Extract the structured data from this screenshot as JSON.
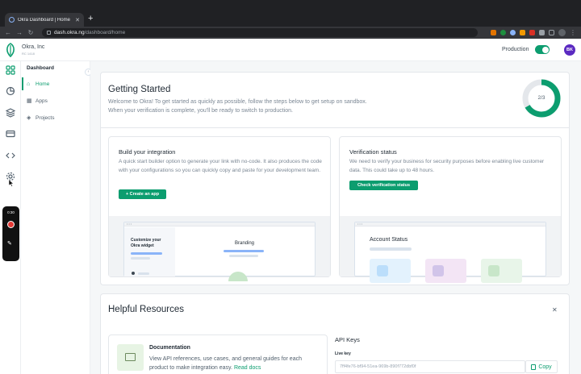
{
  "browser": {
    "tab_title": "Okra Dashboard | Home",
    "tab_close": "✕",
    "new_tab": "+",
    "url_host": "dash.okra.ng",
    "url_path": "/dashboard/home"
  },
  "header": {
    "org_name": "Okra, Inc",
    "org_id": "RC 1418",
    "env_label": "Production",
    "production_enabled": true,
    "avatar_initials": "BK"
  },
  "sidebar": {
    "title": "Dashboard",
    "items": [
      {
        "label": "Home",
        "icon": "home-icon",
        "active": true
      },
      {
        "label": "Apps",
        "icon": "apps-icon",
        "active": false
      },
      {
        "label": "Projects",
        "icon": "projects-icon",
        "active": false
      }
    ]
  },
  "recorder": {
    "time": "0:30"
  },
  "getting_started": {
    "title": "Getting Started",
    "desc_line1": "Welcome to Okra! To get started as quickly as possible, follow the steps below to get setup on sandbox.",
    "desc_line2": "When your verification is complete, you'll be ready to switch to production.",
    "progress_label": "2/3",
    "progress_done": 2,
    "progress_total": 3
  },
  "build": {
    "title": "Build your integration",
    "desc": "A quick start builder option to generate your link with no-code. It also produces the code with your configurations so you can quickly copy and paste for your development team.",
    "button": "+ Create an app",
    "mock_left": "Customize your Okra widget",
    "mock_right": "Branding"
  },
  "verify": {
    "title": "Verification status",
    "desc": "We need to verify your business for security purposes before enabling live customer data. This could take up to 48 hours.",
    "button": "Check verification status",
    "mock_title": "Account Status"
  },
  "resources": {
    "title": "Helpful Resources",
    "close": "✕",
    "doc_title": "Documentation",
    "doc_desc": "View API references, use cases, and general guides for each product to make integration easy.",
    "doc_link": "Read docs",
    "api_title": "API Keys",
    "live_key_label": "Live key",
    "live_key_value": "7ff4fe76-bf94-51ea-969b-890f772dbf0f",
    "copy_label": "Copy"
  },
  "colors": {
    "accent": "#0c9d6f",
    "avatar": "#5b2ac1"
  }
}
